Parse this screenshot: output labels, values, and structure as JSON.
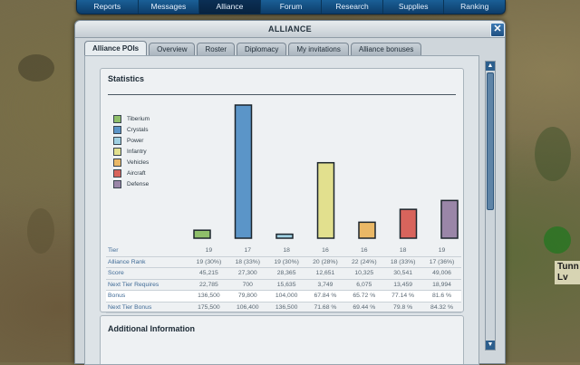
{
  "menu": [
    "Reports",
    "Messages",
    "Alliance",
    "Forum",
    "Research",
    "Supplies",
    "Ranking"
  ],
  "window": {
    "title": "ALLIANCE",
    "close": "✕"
  },
  "tabs": [
    "Alliance POIs",
    "Overview",
    "Roster",
    "Diplomacy",
    "My invitations",
    "Alliance bonuses"
  ],
  "statistics": {
    "title": "Statistics",
    "legend": [
      {
        "label": "Tiberium",
        "color": "#8fbf6a"
      },
      {
        "label": "Crystals",
        "color": "#5b95c8"
      },
      {
        "label": "Power",
        "color": "#9fd0e2"
      },
      {
        "label": "Infantry",
        "color": "#e2e08e"
      },
      {
        "label": "Vehicles",
        "color": "#eab866"
      },
      {
        "label": "Aircraft",
        "color": "#d8645c"
      },
      {
        "label": "Defense",
        "color": "#9a86a8"
      }
    ]
  },
  "chart_data": {
    "type": "bar",
    "categories": [
      "Tiberium",
      "Crystals",
      "Power",
      "Infantry",
      "Vehicles",
      "Aircraft",
      "Defense"
    ],
    "values": [
      1.8,
      30.0,
      0.9,
      17.0,
      3.6,
      6.5,
      8.5
    ],
    "colors": [
      "#8fbf6a",
      "#5b95c8",
      "#9fd0e2",
      "#e2e08e",
      "#eab866",
      "#d8645c",
      "#9a86a8"
    ],
    "ylim": [
      0,
      30
    ]
  },
  "table": {
    "rows": [
      {
        "label": "Tier",
        "cells": [
          "19",
          "17",
          "18",
          "16",
          "16",
          "18",
          "19"
        ]
      },
      {
        "label": "Alliance Rank",
        "cells": [
          "19 (30%)",
          "18 (33%)",
          "19 (30%)",
          "20 (28%)",
          "22 (24%)",
          "18 (33%)",
          "17 (36%)"
        ]
      },
      {
        "label": "Score",
        "cells": [
          "45,215",
          "27,300",
          "28,365",
          "12,651",
          "10,325",
          "30,541",
          "49,006"
        ]
      },
      {
        "label": "Next Tier Requires",
        "cells": [
          "22,785",
          "700",
          "15,635",
          "3,749",
          "6,075",
          "13,459",
          "18,994"
        ]
      },
      {
        "label": "Bonus",
        "cells": [
          "136,500",
          "79,800",
          "104,000",
          "67.84 %",
          "65.72 %",
          "77.14 %",
          "81.6 %"
        ]
      },
      {
        "label": "Next Tier Bonus",
        "cells": [
          "175,500",
          "106,400",
          "136,500",
          "71.68 %",
          "69.44 %",
          "79.8 %",
          "84.32 %"
        ]
      }
    ]
  },
  "additional": {
    "title": "Additional Information"
  },
  "side": {
    "label": "Tunn\nLv"
  }
}
